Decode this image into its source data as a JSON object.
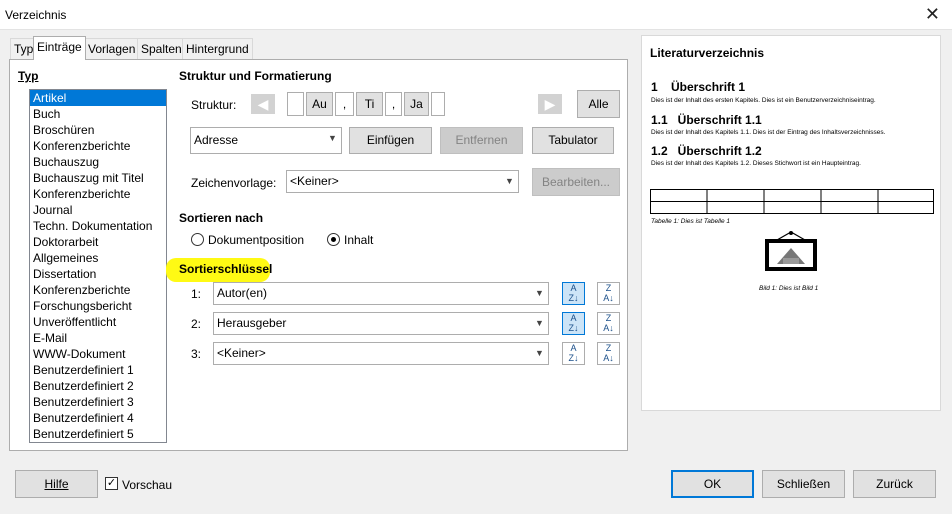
{
  "window": {
    "title": "Verzeichnis",
    "close_glyph": "✕"
  },
  "tabs": [
    "Typ",
    "Einträge",
    "Vorlagen",
    "Spalten",
    "Hintergrund"
  ],
  "type_section": {
    "heading": "Typ",
    "items": [
      "Artikel",
      "Buch",
      "Broschüren",
      "Konferenzberichte",
      "Buchauszug",
      "Buchauszug mit Titel",
      "Konferenzberichte",
      "Journal",
      "Techn. Dokumentation",
      "Doktorarbeit",
      "Allgemeines",
      "Dissertation",
      "Konferenzberichte",
      "Forschungsbericht",
      "Unveröffentlicht",
      "E-Mail",
      "WWW-Dokument",
      "Benutzerdefiniert 1",
      "Benutzerdefiniert 2",
      "Benutzerdefiniert 3",
      "Benutzerdefiniert 4",
      "Benutzerdefiniert 5"
    ],
    "selected": "Artikel"
  },
  "structure": {
    "heading": "Struktur und Formatierung",
    "label": "Struktur:",
    "tokens": [
      "",
      "Au",
      ",",
      "Ti",
      ",",
      "Ja",
      ""
    ],
    "all_button": "Alle",
    "field_select": "Adresse",
    "insert_button": "Einfügen",
    "remove_button": "Entfernen",
    "tab_button": "Tabulator",
    "charstyle_label": "Zeichenvorlage:",
    "charstyle_value": "<Keiner>",
    "edit_button": "Bearbeiten..."
  },
  "sort": {
    "heading": "Sortieren nach",
    "option_docpos": "Dokumentposition",
    "option_content": "Inhalt",
    "selected": "Inhalt"
  },
  "sortkeys": {
    "heading": "Sortierschlüssel",
    "rows": [
      {
        "label": "1:",
        "value": "Autor(en)",
        "ascending_active": true
      },
      {
        "label": "2:",
        "value": "Herausgeber",
        "ascending_active": true
      },
      {
        "label": "3:",
        "value": "<Keiner>",
        "ascending_active": false
      }
    ]
  },
  "preview": {
    "title": "Literaturverzeichnis",
    "h1": "1    Überschrift 1",
    "t1": "Dies ist der Inhalt des ersten Kapitels. Dies ist ein Benutzerverzeichniseintrag.",
    "h11": "1.1   Überschrift 1.1",
    "t11": "Dies ist der Inhalt des Kapitels 1.1. Dies ist der Eintrag des Inhaltsverzeichnisses.",
    "h12": "1.2   Überschrift 1.2",
    "t12": "Dies ist der Inhalt des Kapitels 1.2. Dieses Stichwort ist ein Haupteintrag.",
    "table_caption": "Tabelle 1: Dies ist Tabelle 1",
    "image_caption": "Bild 1: Dies ist Bild 1"
  },
  "footer": {
    "help": "Hilfe",
    "preview_label": "Vorschau",
    "preview_checked": true,
    "ok": "OK",
    "close": "Schließen",
    "back": "Zurück"
  },
  "colors": {
    "accent": "#0078d7",
    "highlight": "#fffa14"
  }
}
